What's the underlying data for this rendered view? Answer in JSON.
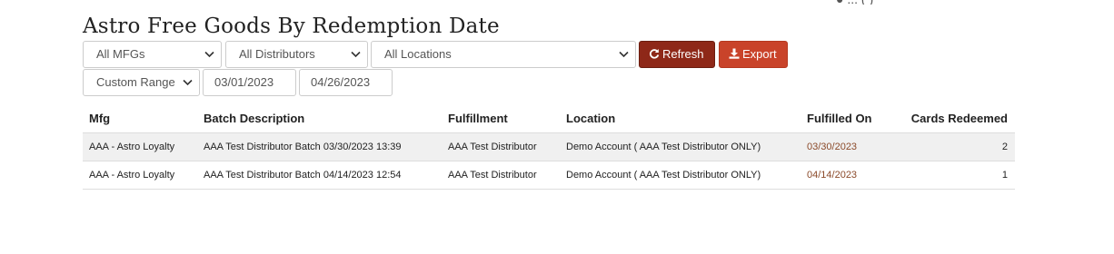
{
  "page": {
    "title": "Astro Free Goods By Redemption Date",
    "top_clipped_text": "● ... (                    )"
  },
  "filters": {
    "mfg_select": "All MFGs",
    "distributor_select": "All Distributors",
    "location_select": "All Locations",
    "range_select": "Custom Range",
    "start_date": "03/01/2023",
    "end_date": "04/26/2023"
  },
  "buttons": {
    "refresh_label": "Refresh",
    "export_label": "Export",
    "refresh_icon": "refresh-icon",
    "export_icon": "download-icon",
    "refresh_color": "#8e2818",
    "export_color": "#c9432a"
  },
  "table": {
    "headers": {
      "mfg": "Mfg",
      "batch": "Batch Description",
      "fulfillment": "Fulfillment",
      "location": "Location",
      "fulfilled_on": "Fulfilled On",
      "cards": "Cards Redeemed"
    },
    "rows": [
      {
        "mfg": "AAA - Astro Loyalty",
        "batch": "AAA Test Distributor Batch 03/30/2023 13:39",
        "fulfillment": "AAA Test Distributor",
        "location": "Demo Account ( AAA Test Distributor ONLY)",
        "fulfilled_on": "03/30/2023",
        "cards": "2"
      },
      {
        "mfg": "AAA - Astro Loyalty",
        "batch": "AAA Test Distributor Batch 04/14/2023 12:54",
        "fulfillment": "AAA Test Distributor",
        "location": "Demo Account ( AAA Test Distributor ONLY)",
        "fulfilled_on": "04/14/2023",
        "cards": "1"
      }
    ]
  }
}
